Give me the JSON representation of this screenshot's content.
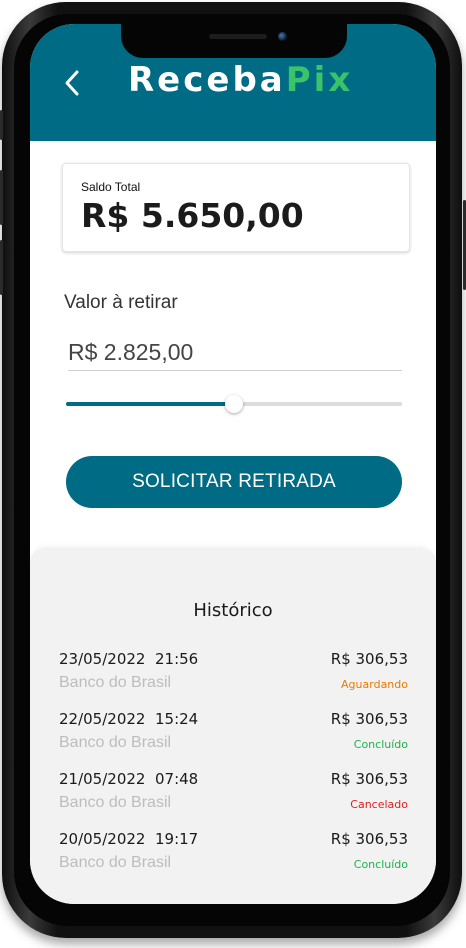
{
  "header": {
    "brand_main": "Receba",
    "brand_accent": "Pix",
    "back_icon": "chevron-left-icon",
    "color": "#006b84",
    "accent_color": "#39c46a"
  },
  "balance": {
    "label": "Saldo Total",
    "value": "R$ 5.650,00"
  },
  "withdraw": {
    "label": "Valor à retirar",
    "value": "R$ 2.825,00",
    "slider_fraction": 0.5
  },
  "action": {
    "button_label": "SOLICITAR RETIRADA"
  },
  "history": {
    "title": "Histórico",
    "items": [
      {
        "datetime": "23/05/2022  21:56",
        "bank": "Banco do Brasil",
        "amount": "R$ 306,53",
        "status": "Aguardando",
        "status_color": "#e87b00"
      },
      {
        "datetime": "22/05/2022  15:24",
        "bank": "Banco do Brasil",
        "amount": "R$ 306,53",
        "status": "Concluído",
        "status_color": "#1bb34a"
      },
      {
        "datetime": "21/05/2022  07:48",
        "bank": "Banco do Brasil",
        "amount": "R$ 306,53",
        "status": "Cancelado",
        "status_color": "#e0201b"
      },
      {
        "datetime": "20/05/2022  19:17",
        "bank": "Banco do Brasil",
        "amount": "R$ 306,53",
        "status": "Concluído",
        "status_color": "#1bb34a"
      }
    ]
  }
}
